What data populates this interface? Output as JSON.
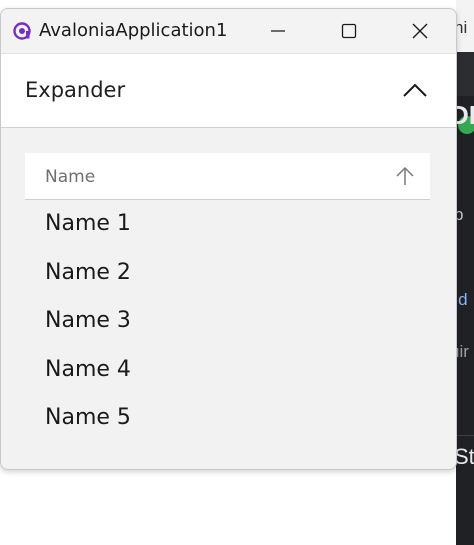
{
  "window": {
    "title": "AvaloniaApplication1",
    "minimize_icon": "minimize-icon",
    "maximize_icon": "maximize-icon",
    "close_icon": "close-icon",
    "app_icon": "avalonia-logo-icon"
  },
  "expander": {
    "header": "Expander",
    "expanded": true,
    "toggle_icon": "chevron-up-icon"
  },
  "grid": {
    "columns": [
      {
        "label": "Name",
        "sort": "ascending",
        "sort_icon": "arrow-up-icon"
      }
    ],
    "rows": [
      {
        "name": "Name 1"
      },
      {
        "name": "Name 2"
      },
      {
        "name": "Name 3"
      },
      {
        "name": "Name 4"
      },
      {
        "name": "Name 5"
      }
    ]
  },
  "background_app": {
    "fragments": [
      "ni",
      "DI",
      "p",
      "a d",
      "uir",
      "Sta"
    ]
  },
  "colors": {
    "accent": "#7b2dbb",
    "window_bg": "#f2f2f2",
    "header_bg": "#ffffff",
    "bg_app_dark": "#202124",
    "bg_app_link": "#8ab4f8",
    "bg_app_green": "#34a853"
  }
}
